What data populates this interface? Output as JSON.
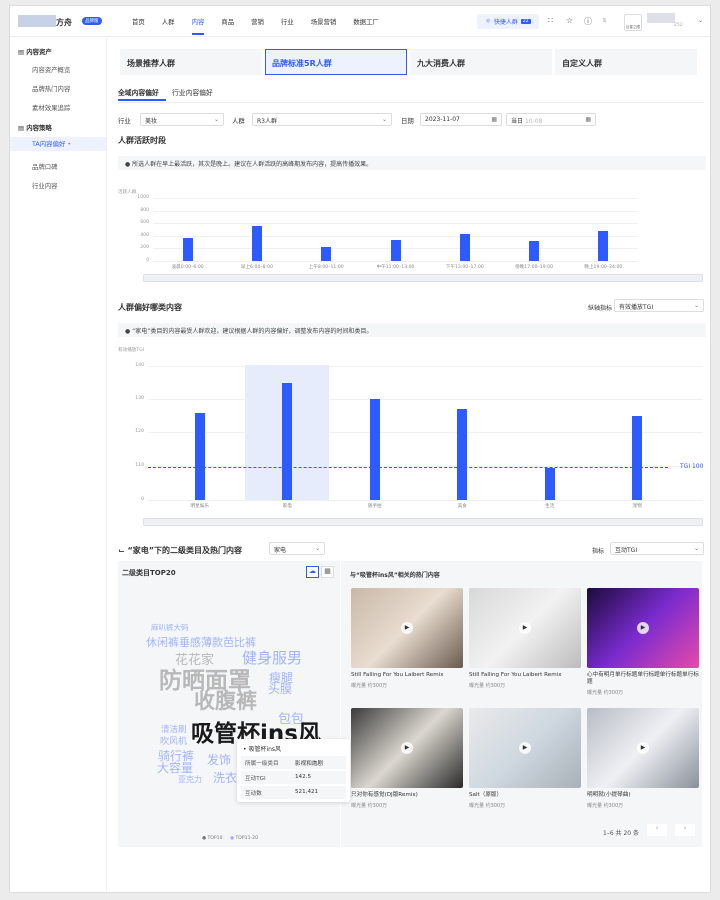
{
  "brand": {
    "name": "方舟",
    "badge": "品牌版"
  },
  "nav": {
    "items": [
      "首页",
      "人群",
      "内容",
      "商品",
      "营销",
      "行业",
      "场景营销",
      "数据工厂"
    ],
    "active_index": 2
  },
  "top": {
    "quick_label": "快捷人群",
    "quick_badge": "22",
    "user_avatar_text": "巨星之眼",
    "user_id": "252"
  },
  "sidebar": {
    "group1": "内容资产",
    "g1_items": [
      "内容资产概览",
      "品牌热门内容",
      "素材效果追踪"
    ],
    "group2": "内容策略",
    "g2_items": [
      "TA内容偏好",
      "品牌口碑",
      "行业内容"
    ],
    "active": "TA内容偏好"
  },
  "tabs": [
    "场景推荐人群",
    "品牌标准5R人群",
    "九大消费人群",
    "自定义人群"
  ],
  "subtabs": [
    "全域内容偏好",
    "行业内容偏好"
  ],
  "filters": {
    "industry_label": "行业",
    "industry_value": "美妆",
    "crowd_label": "人群",
    "crowd_value": "R3人群",
    "date_label": "日期",
    "date_value": "2023-11-07",
    "date_type": "当日",
    "date_type_ph": "10-08"
  },
  "section1": {
    "title": "人群活跃时段",
    "tip": "所选人群在早上最活跃，其次是晚上。建议在人群活跃的高峰期发布内容，提高传播效果。"
  },
  "section2": {
    "title": "人群偏好哪类内容",
    "metric_label": "纵轴指标",
    "metric_value": "有效播放TGI",
    "tip": "“家电”类目的内容最受人群欢迎，建议根据人群的内容偏好，调整发布内容的时间和类目。",
    "tgi_line_label": "TGI 100"
  },
  "section3": {
    "title": "“家电”下的二级类目及热门内容",
    "category_select": "家电",
    "indicator_label": "指标",
    "indicator_value": "互动TGI",
    "left_title": "二级类目TOP20",
    "right_title": "与“吸管杯ins风”相关的热门内容",
    "legend": [
      "TOP10",
      "TOP11-20"
    ],
    "pager": "1–6 共 20 条"
  },
  "tooltip": {
    "title": "吸管杯ins风",
    "rows": [
      [
        "所属一级类目",
        "影视和炮剧"
      ],
      [
        "互动TGI",
        "142.5"
      ],
      [
        "互动数",
        "521,421"
      ]
    ]
  },
  "words": [
    {
      "t": "麻叭裤大码",
      "c": "#9fb4ff",
      "s": 7.5
    },
    {
      "t": "休闲裤垂感薄款芭比裤",
      "c": "#9fb4ff",
      "s": 11
    },
    {
      "t": "花花家",
      "c": "#b8b8b8",
      "s": 13
    },
    {
      "t": "健身服男",
      "c": "#9fb4ff",
      "s": 15
    },
    {
      "t": "防晒面罩",
      "c": "#b8b8b8",
      "s": 23
    },
    {
      "t": "瘦腿",
      "c": "#9fb4ff",
      "s": 12
    },
    {
      "t": "头膜",
      "c": "#9fb4ff",
      "s": 12
    },
    {
      "t": "收腹裤",
      "c": "#b8b8b8",
      "s": 21
    },
    {
      "t": "包包",
      "c": "#9fb4ff",
      "s": 13
    },
    {
      "t": "清洁刷",
      "c": "#9fb4ff",
      "s": 8.5
    },
    {
      "t": "吸管杯ins风",
      "c": "#1a1a1a",
      "s": 23
    },
    {
      "t": "吹风机",
      "c": "#9fb4ff",
      "s": 9
    },
    {
      "t": "骑行裤",
      "c": "#9fb4ff",
      "s": 12
    },
    {
      "t": "大容量",
      "c": "#9fb4ff",
      "s": 12
    },
    {
      "t": "发饰",
      "c": "#9fb4ff",
      "s": 12
    },
    {
      "t": "亚克力",
      "c": "#9fb4ff",
      "s": 8
    },
    {
      "t": "洗衣",
      "c": "#9fb4ff",
      "s": 12
    }
  ],
  "contents": [
    {
      "title": "Still Falling For You Laibert Remix",
      "exposure": "曝光量 约300万"
    },
    {
      "title": "Still Falling For You Laibert Remix",
      "exposure": "曝光量 约300万"
    },
    {
      "title": "心中有明月单行标题单行标题单行标题单行标题",
      "exposure": "曝光量 约300万"
    },
    {
      "title": "只对你有感觉(DJ版Remix)",
      "exposure": "曝光量 约300万"
    },
    {
      "title": "Salt（原版）",
      "exposure": "曝光量 约300万"
    },
    {
      "title": "明明就(小提琴曲)",
      "exposure": "曝光量 约300万"
    }
  ],
  "chart_data": [
    {
      "type": "bar",
      "title": "人群活跃时段",
      "ylabel": "活跃人群",
      "ylim": [
        0,
        1000
      ],
      "yticks": [
        0,
        200,
        400,
        600,
        800,
        1000
      ],
      "categories": [
        "凌晨0:00–6:00",
        "早上6:00–8:00",
        "上午8:00–11:00",
        "中午11:00–13:00",
        "下午13:00–17:00",
        "傍晚17:00–19:00",
        "晚上19:00–24:00"
      ],
      "values": [
        370,
        560,
        220,
        330,
        430,
        310,
        470
      ]
    },
    {
      "type": "bar",
      "title": "人群偏好哪类内容",
      "ylabel": "有效播放TGI",
      "ylim": [
        0,
        140
      ],
      "yticks": [
        0,
        50,
        100,
        120,
        130,
        140
      ],
      "tick_labels": [
        "0",
        "110",
        "120",
        "130",
        "140"
      ],
      "categories": [
        "明星娱乐",
        "家电",
        "随手拍",
        "美食",
        "生活",
        "宠物"
      ],
      "values": [
        126,
        135,
        130,
        127,
        104,
        125
      ],
      "reference_line": {
        "label": "TGI 100",
        "value": 107
      },
      "highlight": "家电"
    }
  ]
}
